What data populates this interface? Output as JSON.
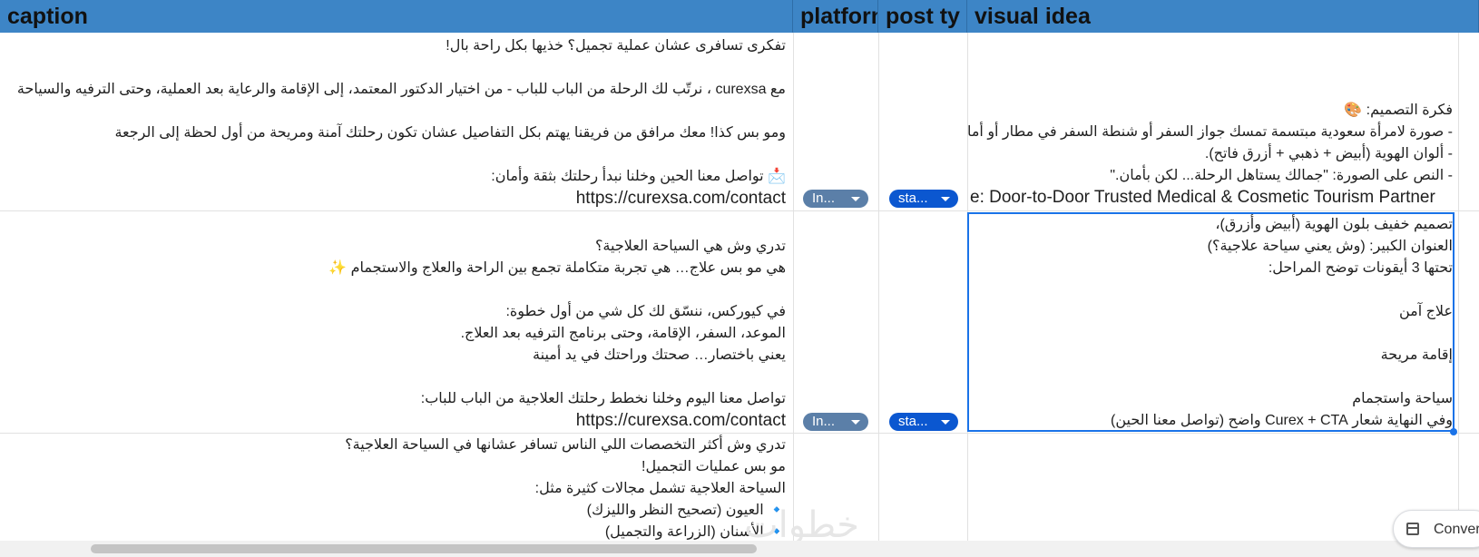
{
  "headers": {
    "caption": "caption",
    "platform": "platforn",
    "post_type": "post ty",
    "visual_idea": "visual idea"
  },
  "rows": [
    {
      "caption": [
        "تفكرى تسافرى عشان عملية تجميل؟ خذيها بكل راحة بال!",
        "",
        "مع curexsa ، نرتّب لك الرحلة من الباب للباب - من اختيار الدكتور المعتمد، إلى الإقامة والرعاية بعد العملية، وحتى الترفيه والسياحة",
        "",
        "ومو بس كذا! معك مرافق من فريقنا يهتم بكل التفاصيل عشان تكون رحلتك آمنة ومريحة من أول لحظة إلى الرجعة",
        "",
        "📩 تواصل معنا الحين وخلنا نبدأ رحلتك بثقة وأمان:"
      ],
      "url": "https://curexsa.com/contact",
      "platform": "In...",
      "post_type": "sta...",
      "visual": [
        "فكرة التصميم: 🎨",
        "- صورة لامرأة سعودية مبتسمة تمسك جواز السفر أو شنطة السفر في مطار أو أمام ط",
        "- ألوان الهوية (أبيض + ذهبي + أزرق فاتح).",
        "- النص على الصورة: \"جمالك يستاهل الرحلة... لكن بأمان.\""
      ],
      "visual_tagline": "e: Door-to-Door Trusted Medical & Cosmetic Tourism Partner"
    },
    {
      "caption": [
        "تدري وش هي السياحة العلاجية؟",
        "هي مو بس علاج… هي تجربة متكاملة تجمع بين الراحة والعلاج والاستجمام ✨",
        "",
        "في كيوركس، ننسّق لك كل شي من أول خطوة:",
        "الموعد، السفر، الإقامة، وحتى برنامج الترفيه بعد العلاج.",
        "يعني باختصار… صحتك وراحتك في يد أمينة",
        "",
        "تواصل معنا اليوم وخلنا نخطط رحلتك العلاجية من الباب للباب:"
      ],
      "url": "https://curexsa.com/contact",
      "platform": "In...",
      "post_type": "sta...",
      "visual": [
        "تصميم خفيف بلون الهوية (أبيض وأزرق)،",
        "العنوان الكبير: (وش يعني سياحة علاجية؟)",
        "تحتها 3 أيقونات توضح المراحل:",
        "",
        "علاج آمن",
        "",
        "إقامة مريحة",
        "",
        "سياحة واستجمام",
        "وفي النهاية شعار Curex + CTA واضح (تواصل معنا الحين)"
      ]
    },
    {
      "caption": [
        "تدري وش أكثر التخصصات اللي الناس تسافر عشانها في السياحة العلاجية؟",
        "مو بس عمليات التجميل!",
        "السياحة العلاجية تشمل مجالات كثيرة مثل:",
        "🔹 العيون  (تصحيح النظر والليزك)",
        "🔹 الأسنان  (الزراعة والتجميل)"
      ]
    }
  ],
  "watermark": "خطوات",
  "convert_button": "Convert"
}
